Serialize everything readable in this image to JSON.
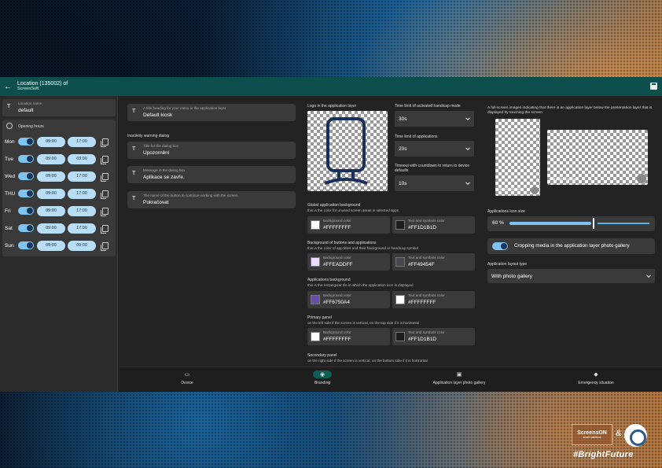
{
  "header": {
    "title": "Location (135002) of",
    "subtitle": "ScreenSoft"
  },
  "location": {
    "label": "Location name",
    "value": "default"
  },
  "opening_hours": {
    "title": "Opening hours",
    "days": [
      {
        "day": "Mon",
        "from": "09:00",
        "to": "17:00"
      },
      {
        "day": "Tue",
        "from": "09:00",
        "to": "03:00"
      },
      {
        "day": "Wed",
        "from": "09:00",
        "to": "17:00"
      },
      {
        "day": "THU",
        "from": "09:00",
        "to": "17:00"
      },
      {
        "day": "Fri",
        "from": "09:00",
        "to": "17:00"
      },
      {
        "day": "Sat",
        "from": "09:00",
        "to": "17:00"
      },
      {
        "day": "Sun",
        "from": "09:00",
        "to": "09:00"
      }
    ]
  },
  "menu_heading": {
    "label": "A title heading for your menu in the application layer",
    "value": "Default kiosk"
  },
  "inactivity": {
    "title": "Inactivity warning dialog",
    "title_field": {
      "label": "Title for the dialog box",
      "value": "Upozornění"
    },
    "message_field": {
      "label": "Message in the dialog box",
      "value": "Aplikace se zavře."
    },
    "button_field": {
      "label": "The name of the button to continue working with the screen",
      "value": "Pokračovat"
    }
  },
  "logo": {
    "title": "Logo in the application layer"
  },
  "handicap_time": {
    "label": "Time limit of activated handicap mode",
    "value": "30s"
  },
  "app_time": {
    "label": "Time limit of applications",
    "value": "20s"
  },
  "timeout": {
    "label": "Timeout with countdown to return to device defaults",
    "value": "10s"
  },
  "fullscreen": {
    "label": "A full-screen images indicating that there is an application layer below the presentation layer that is displayed by touching the screen",
    "vertical": "Vertical screen",
    "horizontal": "Horizontal screen"
  },
  "colors": {
    "bg_label": "Background color",
    "text_label": "Text and symbols color",
    "global": {
      "title": "Global application background",
      "desc": "this is the color for unused screen areas in selected apps",
      "bg": "#FFFFFFFF",
      "text": "#FF1D1B1D",
      "bg_swatch": "#FFFFFF",
      "text_swatch": "#1D1B1D"
    },
    "buttons": {
      "title": "Background of buttons and applications",
      "desc": "this is the color of app titles and their background or handicap symbol",
      "bg": "#FFEADDFF",
      "text": "#FF49454F",
      "bg_swatch": "#EADDFF",
      "text_swatch": "#49454F"
    },
    "apps": {
      "title": "Applications background",
      "desc": "this is the rectangular tile in which the application icon is displayed",
      "bg": "#FF6750A4",
      "text": "#FFFFFFFF",
      "bg_swatch": "#6750A4",
      "text_swatch": "#FFFFFF"
    },
    "primary": {
      "title": "Primary panel",
      "desc": "on the left side if the screen is vertical, on the top side if it is horizontal",
      "bg": "#FFFFFFFF",
      "text": "#FF1D1B1D",
      "bg_swatch": "#FFFFFF",
      "text_swatch": "#1D1B1D"
    },
    "secondary": {
      "title": "Secondary panel",
      "desc": "on the right side if the screen is vertical, on the bottom side if it is horizontal"
    }
  },
  "icon_size": {
    "label": "Applications icon size",
    "value": "60 %",
    "level": 0.6
  },
  "cropping": {
    "label": "Cropping media in the application layer photo gallery"
  },
  "layout_type": {
    "label": "Application layout type",
    "value": "With photo gallery"
  },
  "nav": {
    "device": "Device",
    "branding": "Branding",
    "gallery": "Application layer photo gallery",
    "emergency": "Emergency situation"
  },
  "brand": {
    "name": "ScreensON",
    "tagline": "smart solutions",
    "amp": "&",
    "hashtag": "#BrightFuture"
  }
}
